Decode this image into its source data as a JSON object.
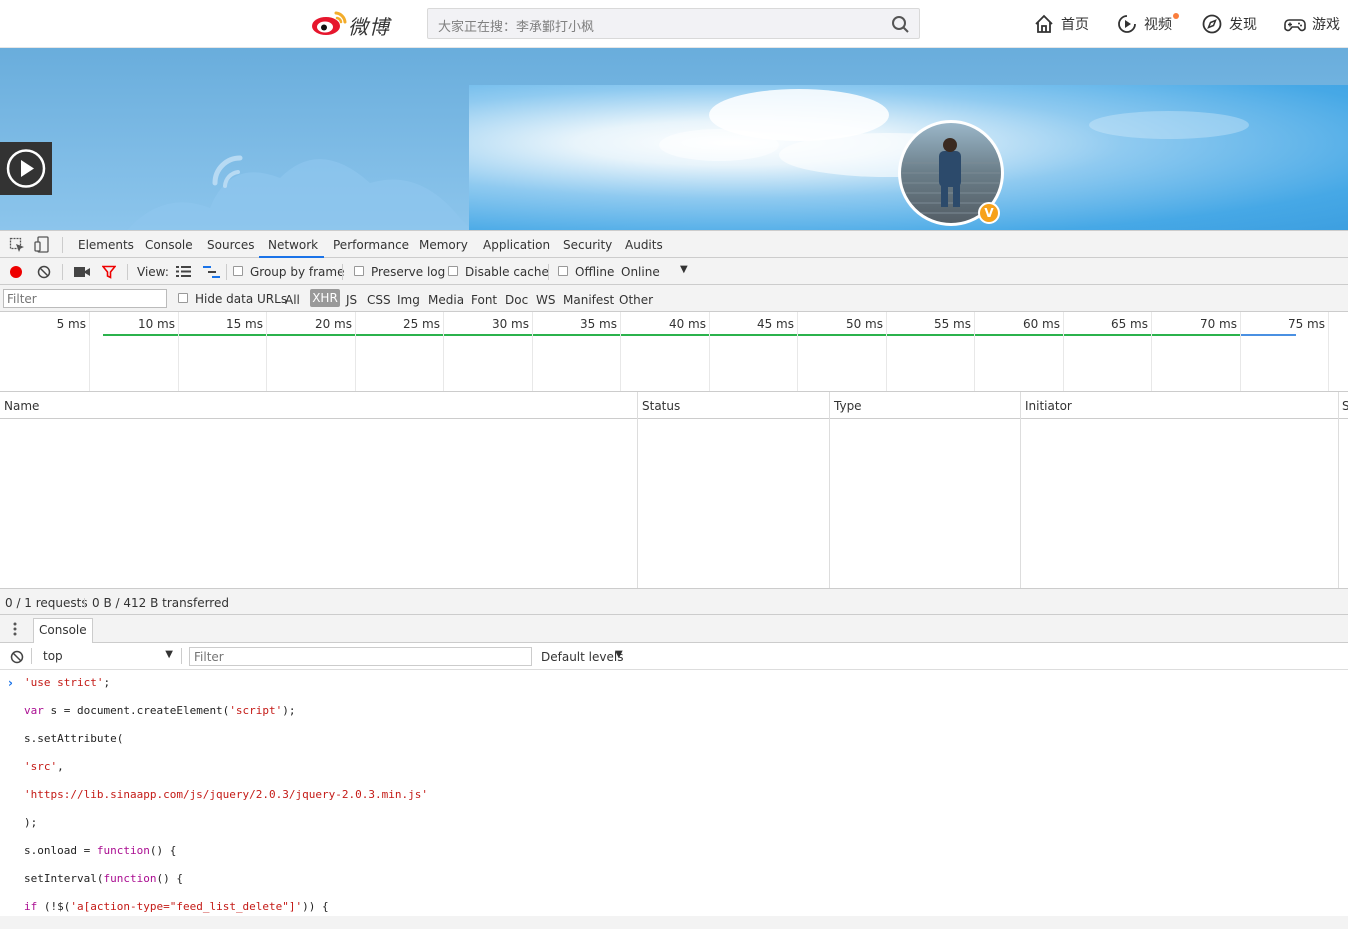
{
  "topnav": {
    "logo_text": "微博",
    "search_placeholder": "大家正在搜：李承鄞打小枫",
    "items": [
      {
        "label": "首页",
        "icon": "home-icon"
      },
      {
        "label": "视频",
        "icon": "video-icon"
      },
      {
        "label": "发现",
        "icon": "compass-icon"
      },
      {
        "label": "游戏",
        "icon": "gamepad-icon"
      }
    ]
  },
  "profile": {
    "verified_badge": "V"
  },
  "devtools": {
    "tabs": [
      "Elements",
      "Console",
      "Sources",
      "Network",
      "Performance",
      "Memory",
      "Application",
      "Security",
      "Audits"
    ],
    "active_tab": "Network",
    "network_toolbar": {
      "view_label": "View:",
      "group_by_frame": "Group by frame",
      "preserve_log": "Preserve log",
      "disable_cache": "Disable cache",
      "offline": "Offline",
      "throttle": "Online"
    },
    "filter_bar": {
      "placeholder": "Filter",
      "hide_data_urls": "Hide data URLs",
      "types": [
        "All",
        "XHR",
        "JS",
        "CSS",
        "Img",
        "Media",
        "Font",
        "Doc",
        "WS",
        "Manifest",
        "Other"
      ],
      "active_type": "XHR"
    },
    "timeline_ticks": [
      "5 ms",
      "10 ms",
      "15 ms",
      "20 ms",
      "25 ms",
      "30 ms",
      "35 ms",
      "40 ms",
      "45 ms",
      "50 ms",
      "55 ms",
      "60 ms",
      "65 ms",
      "70 ms",
      "75 ms"
    ],
    "table_columns": [
      "Name",
      "Status",
      "Type",
      "Initiator",
      "S"
    ],
    "status_bar": {
      "requests": "0 / 1 requests",
      "transferred": "0 B / 412 B transferred"
    },
    "drawer": {
      "tab": "Console",
      "context": "top",
      "filter_placeholder": "Filter",
      "levels": "Default levels"
    }
  },
  "console_lines": [
    {
      "parts": [
        [
          "str",
          "'use strict'"
        ],
        [
          "plain",
          ";"
        ]
      ]
    },
    {
      "parts": [
        [
          "kw",
          "var"
        ],
        [
          "plain",
          " s = document.createElement("
        ],
        [
          "str",
          "'script'"
        ],
        [
          "plain",
          ");"
        ]
      ]
    },
    {
      "parts": [
        [
          "plain",
          "s.setAttribute("
        ]
      ]
    },
    {
      "parts": [
        [
          "str",
          "'src'"
        ],
        [
          "plain",
          ","
        ]
      ]
    },
    {
      "parts": [
        [
          "str",
          "'https://lib.sinaapp.com/js/jquery/2.0.3/jquery-2.0.3.min.js'"
        ]
      ]
    },
    {
      "parts": [
        [
          "plain",
          ");"
        ]
      ]
    },
    {
      "parts": [
        [
          "plain",
          "s.onload = "
        ],
        [
          "kw",
          "function"
        ],
        [
          "plain",
          "() {"
        ]
      ]
    },
    {
      "parts": [
        [
          "plain",
          "setInterval("
        ],
        [
          "kw",
          "function"
        ],
        [
          "plain",
          "() {"
        ]
      ]
    },
    {
      "parts": [
        [
          "kw",
          "if"
        ],
        [
          "plain",
          " (!$("
        ],
        [
          "str",
          "'a[action-type=\"feed_list_delete\"]'"
        ],
        [
          "plain",
          ")) {"
        ]
      ]
    }
  ]
}
